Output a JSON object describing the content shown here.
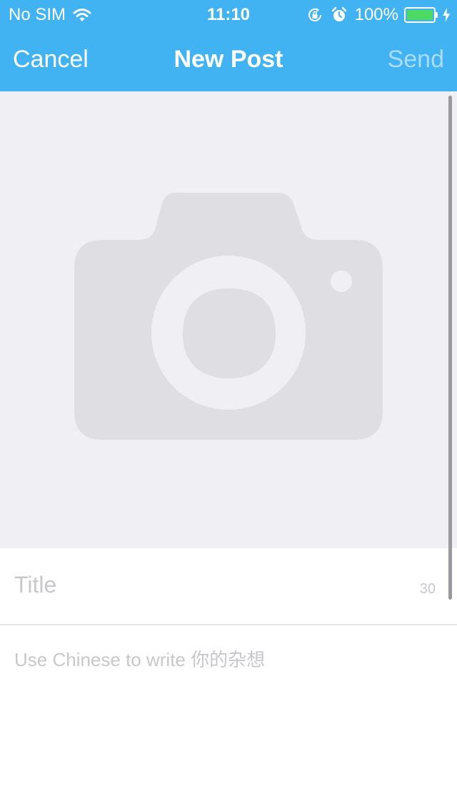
{
  "status_bar": {
    "carrier": "No SIM",
    "time": "11:10",
    "battery_percent": "100%",
    "icons": [
      "wifi-icon",
      "lock-rotation-icon",
      "alarm-icon",
      "battery-icon",
      "charging-icon"
    ]
  },
  "nav": {
    "cancel_label": "Cancel",
    "title": "New Post",
    "send_label": "Send"
  },
  "photo": {
    "icon": "camera-icon"
  },
  "form": {
    "title_placeholder": "Title",
    "title_value": "",
    "char_count": "30",
    "body_placeholder": "Use Chinese to write 你的杂想",
    "body_value": ""
  },
  "colors": {
    "nav_background": "#42b3f2",
    "send_disabled": "#a9dcfa",
    "photo_background": "#efeff4",
    "camera_icon": "#dfdfe3",
    "placeholder": "#c7c7cc",
    "battery_fill": "#4cd964"
  }
}
